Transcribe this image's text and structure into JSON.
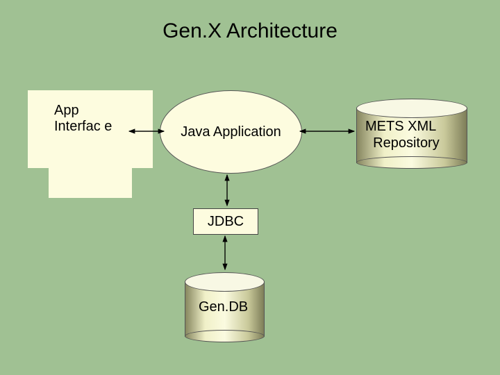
{
  "title": "Gen.X Architecture",
  "nodes": {
    "app_interface": "App Interfac e",
    "java_app": "Java Application",
    "jdbc": "JDBC",
    "mets_repo_line1": "METS XML",
    "mets_repo_line2": "Repository",
    "gendb": "Gen.DB"
  },
  "diagram": {
    "edges": [
      {
        "from": "java_app",
        "to": "app_interface",
        "bidirectional": true
      },
      {
        "from": "java_app",
        "to": "mets_repo",
        "bidirectional": true
      },
      {
        "from": "java_app",
        "to": "jdbc",
        "bidirectional": true
      },
      {
        "from": "jdbc",
        "to": "gendb",
        "bidirectional": true
      }
    ]
  },
  "colors": {
    "background": "#a0c193",
    "node_fill": "#fdfcdf",
    "cylinder_tone": "#c9c99a"
  }
}
